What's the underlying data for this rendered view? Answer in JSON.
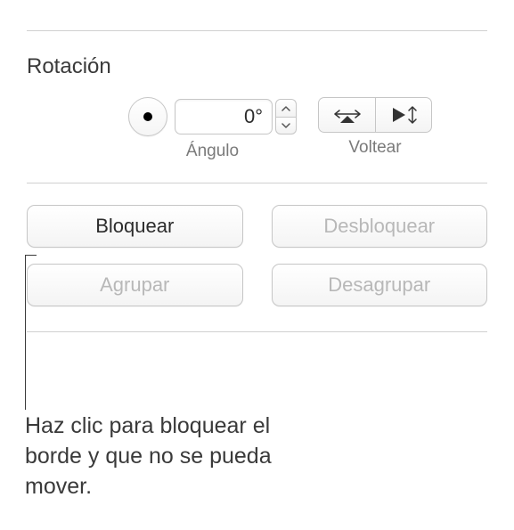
{
  "rotation": {
    "title": "Rotación",
    "angle_value": "0°",
    "angle_label": "Ángulo",
    "flip_label": "Voltear"
  },
  "buttons": {
    "lock": "Bloquear",
    "unlock": "Desbloquear",
    "group": "Agrupar",
    "ungroup": "Desagrupar"
  },
  "annotation": {
    "text": "Haz clic para bloquear el borde y que no se pueda mover."
  }
}
